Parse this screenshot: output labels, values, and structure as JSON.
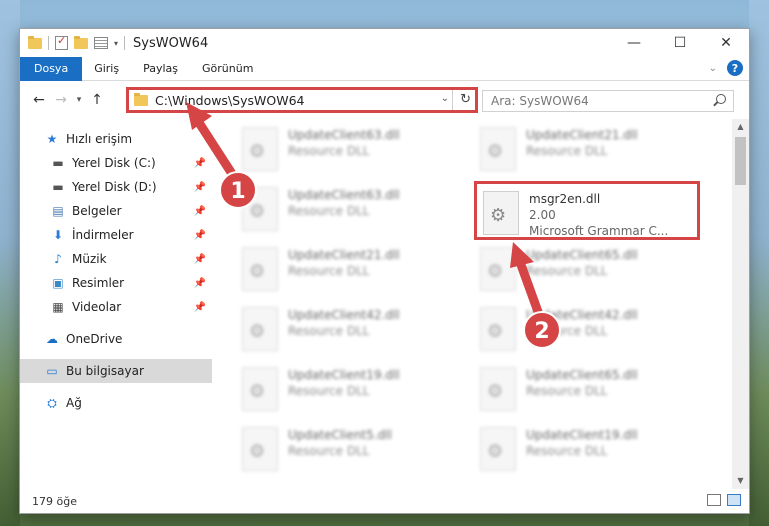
{
  "window": {
    "title": "SysWOW64",
    "controls": {
      "minimize": "—",
      "maximize": "☐",
      "close": "✕"
    }
  },
  "ribbon": {
    "tabs": [
      "Dosya",
      "Giriş",
      "Paylaş",
      "Görünüm"
    ],
    "help": "?"
  },
  "navigation": {
    "address": "C:\\Windows\\SysWOW64",
    "search_placeholder": "Ara: SysWOW64"
  },
  "sidebar": {
    "quick_access": "Hızlı erişim",
    "items": [
      {
        "label": "Yerel Disk (C:)",
        "icon": "drive-icon",
        "pinned": true
      },
      {
        "label": "Yerel Disk (D:)",
        "icon": "drive-icon",
        "pinned": true
      },
      {
        "label": "Belgeler",
        "icon": "documents-icon",
        "pinned": true
      },
      {
        "label": "İndirmeler",
        "icon": "download-icon",
        "pinned": true
      },
      {
        "label": "Müzik",
        "icon": "music-icon",
        "pinned": true
      },
      {
        "label": "Resimler",
        "icon": "pictures-icon",
        "pinned": true
      },
      {
        "label": "Videolar",
        "icon": "videos-icon",
        "pinned": true
      }
    ],
    "onedrive": "OneDrive",
    "this_pc": "Bu bilgisayar",
    "network": "Ağ"
  },
  "files": [
    {
      "name": "UpdateClient63.dll",
      "type": "Resource DLL"
    },
    {
      "name": "UpdateClient21.dll",
      "type": "Resource DLL"
    },
    {
      "name": "UpdateClient63.dll",
      "type": "Resource DLL"
    },
    {
      "name": "msgr2en.dll",
      "version": "2.00",
      "type": "Microsoft Grammar C...",
      "highlighted": true
    },
    {
      "name": "UpdateClient21.dll",
      "type": "Resource DLL"
    },
    {
      "name": "UpdateClient65.dll",
      "type": "Resource DLL"
    },
    {
      "name": "UpdateClient42.dll",
      "type": "Resource DLL"
    },
    {
      "name": "UpdateClient42.dll",
      "type": "Resource DLL"
    },
    {
      "name": "UpdateClient19.dll",
      "type": "Resource DLL"
    },
    {
      "name": "UpdateClient65.dll",
      "type": "Resource DLL"
    },
    {
      "name": "UpdateClient5.dll",
      "type": "Resource DLL"
    },
    {
      "name": "UpdateClient19.dll",
      "type": "Resource DLL"
    }
  ],
  "status": {
    "count": "179 öğe"
  },
  "annotations": {
    "step1": "1",
    "step2": "2",
    "color": "#d64545"
  }
}
